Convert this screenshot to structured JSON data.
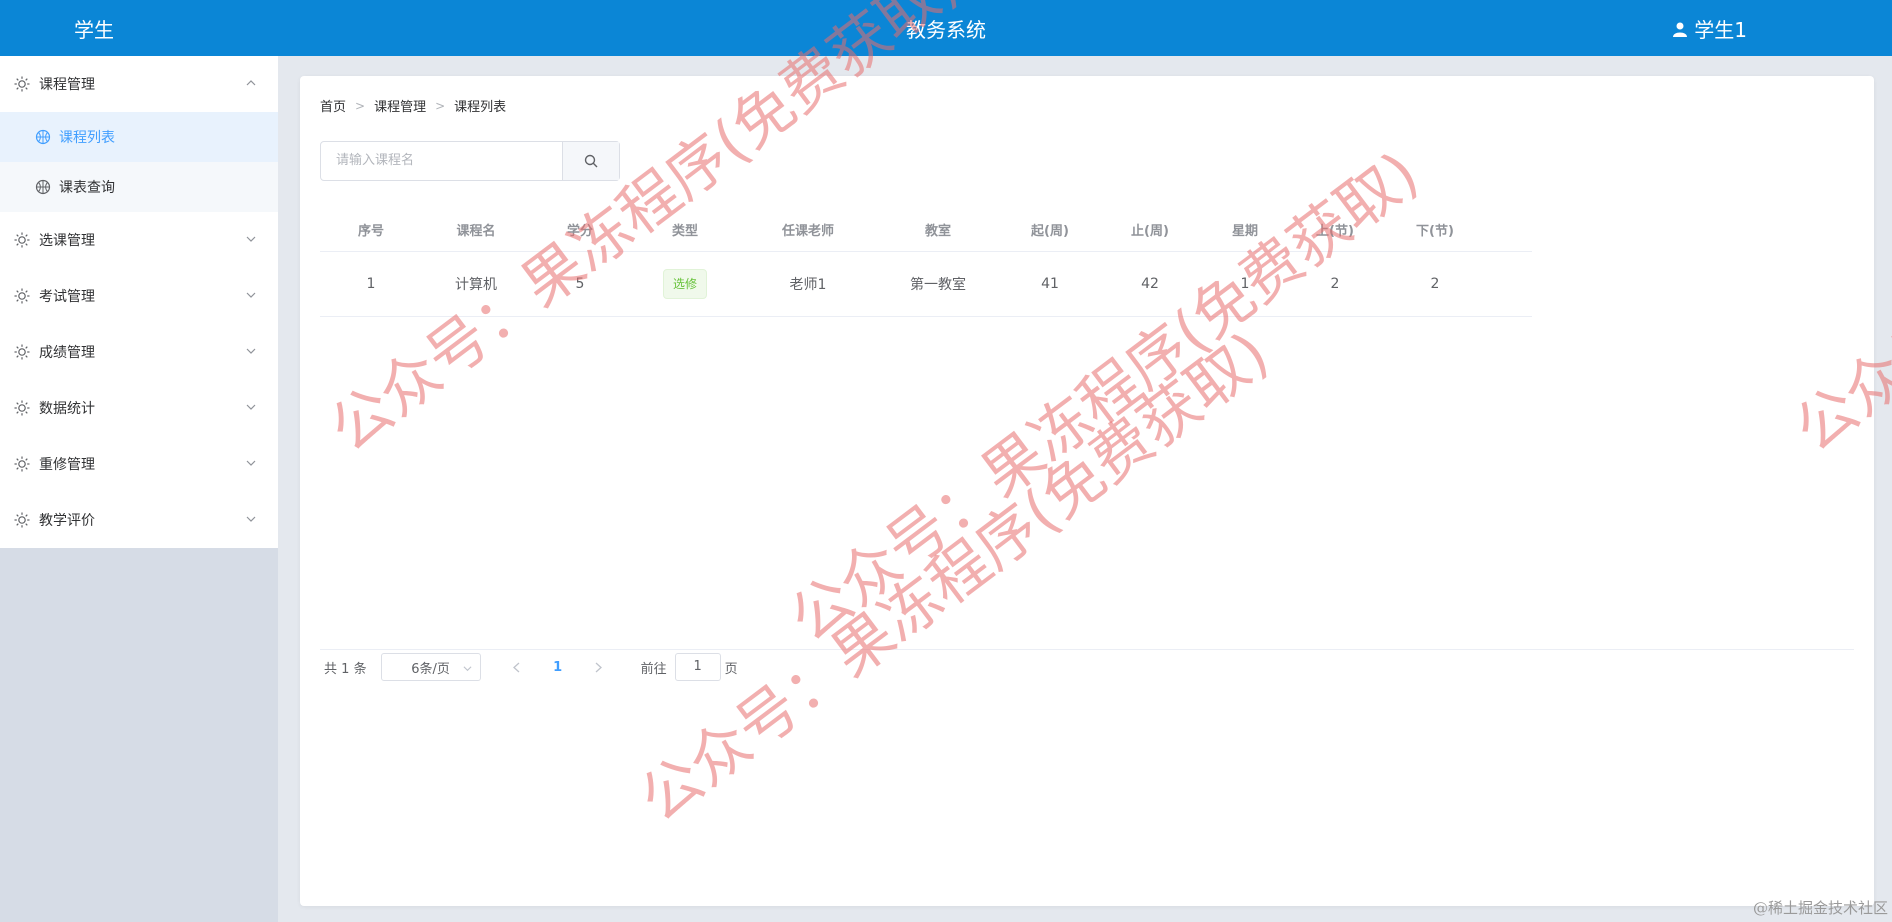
{
  "header": {
    "role": "学生",
    "system_title": "教务系统",
    "user_name": "学生1",
    "user_icon": "user-icon"
  },
  "sidebar": {
    "menus": [
      {
        "label": "课程管理",
        "icon": "sun-icon",
        "expanded": true,
        "children": [
          {
            "label": "课程列表",
            "active": true
          },
          {
            "label": "课表查询",
            "active": false
          }
        ]
      },
      {
        "label": "选课管理",
        "icon": "sun-icon",
        "expanded": false
      },
      {
        "label": "考试管理",
        "icon": "sun-icon",
        "expanded": false
      },
      {
        "label": "成绩管理",
        "icon": "sun-icon",
        "expanded": false
      },
      {
        "label": "数据统计",
        "icon": "sun-icon",
        "expanded": false
      },
      {
        "label": "重修管理",
        "icon": "sun-icon",
        "expanded": false
      },
      {
        "label": "教学评价",
        "icon": "sun-icon",
        "expanded": false
      }
    ]
  },
  "breadcrumb": [
    "首页",
    "课程管理",
    "课程列表"
  ],
  "search": {
    "placeholder": "请输入课程名",
    "value": ""
  },
  "table": {
    "columns": [
      "序号",
      "课程名",
      "学分",
      "类型",
      "任课老师",
      "教室",
      "起(周)",
      "止(周)",
      "星期",
      "上(节)",
      "下(节)"
    ],
    "rows": [
      {
        "index": "1",
        "name": "计算机",
        "credit": "5",
        "type": "选修",
        "teacher": "老师1",
        "room": "第一教室",
        "start_week": "41",
        "end_week": "42",
        "weekday": "1",
        "start_period": "2",
        "end_period": "2"
      }
    ]
  },
  "pagination": {
    "total_prefix": "共",
    "total": "1",
    "total_suffix": "条",
    "page_size": "6条/页",
    "current_page": "1",
    "goto_prefix": "前往",
    "goto_value": "1",
    "goto_suffix": "页"
  },
  "watermark_text": "公众号：果冻程序(免费获取)",
  "footer_credit": "@稀土掘金技术社区",
  "colors": {
    "header_bg": "#0b86d6",
    "active": "#409eff",
    "tag_green": "#67c23a",
    "watermark": "#e86e6e"
  }
}
